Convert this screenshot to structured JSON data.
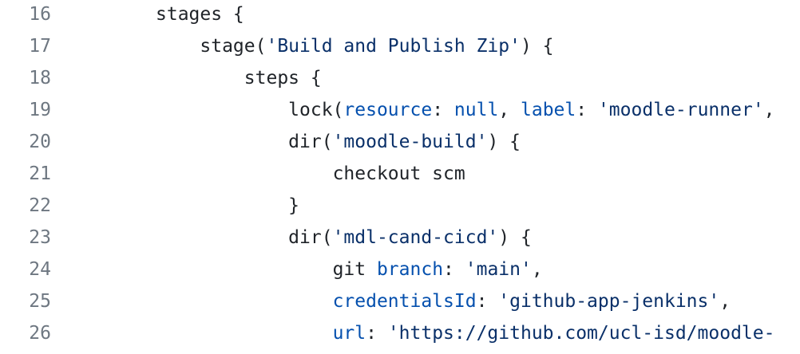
{
  "editor": {
    "lines": [
      {
        "number": "16",
        "indent": "",
        "tokens": [
          {
            "t": "stages {",
            "k": "plain"
          }
        ]
      },
      {
        "number": "17",
        "indent": "    ",
        "tokens": [
          {
            "t": "stage(",
            "k": "plain"
          },
          {
            "t": "'Build and Publish Zip'",
            "k": "string"
          },
          {
            "t": ") {",
            "k": "plain"
          }
        ]
      },
      {
        "number": "18",
        "indent": "        ",
        "tokens": [
          {
            "t": "steps {",
            "k": "plain"
          }
        ]
      },
      {
        "number": "19",
        "indent": "            ",
        "tokens": [
          {
            "t": "lock(",
            "k": "plain"
          },
          {
            "t": "resource",
            "k": "key"
          },
          {
            "t": ": ",
            "k": "plain"
          },
          {
            "t": "null",
            "k": "key"
          },
          {
            "t": ", ",
            "k": "plain"
          },
          {
            "t": "label",
            "k": "key"
          },
          {
            "t": ": ",
            "k": "plain"
          },
          {
            "t": "'moodle-runner'",
            "k": "string"
          },
          {
            "t": ",",
            "k": "plain"
          }
        ]
      },
      {
        "number": "20",
        "indent": "            ",
        "tokens": [
          {
            "t": "dir(",
            "k": "plain"
          },
          {
            "t": "'moodle-build'",
            "k": "string"
          },
          {
            "t": ") {",
            "k": "plain"
          }
        ]
      },
      {
        "number": "21",
        "indent": "                ",
        "tokens": [
          {
            "t": "checkout scm",
            "k": "plain"
          }
        ]
      },
      {
        "number": "22",
        "indent": "            ",
        "tokens": [
          {
            "t": "}",
            "k": "plain"
          }
        ]
      },
      {
        "number": "23",
        "indent": "            ",
        "tokens": [
          {
            "t": "dir(",
            "k": "plain"
          },
          {
            "t": "'mdl-cand-cicd'",
            "k": "string"
          },
          {
            "t": ") {",
            "k": "plain"
          }
        ]
      },
      {
        "number": "24",
        "indent": "                ",
        "tokens": [
          {
            "t": "git ",
            "k": "plain"
          },
          {
            "t": "branch",
            "k": "key"
          },
          {
            "t": ": ",
            "k": "plain"
          },
          {
            "t": "'main'",
            "k": "string"
          },
          {
            "t": ",",
            "k": "plain"
          }
        ]
      },
      {
        "number": "25",
        "indent": "                ",
        "tokens": [
          {
            "t": "credentialsId",
            "k": "key"
          },
          {
            "t": ": ",
            "k": "plain"
          },
          {
            "t": "'github-app-jenkins'",
            "k": "string"
          },
          {
            "t": ",",
            "k": "plain"
          }
        ]
      },
      {
        "number": "26",
        "indent": "                ",
        "tokens": [
          {
            "t": "url",
            "k": "key"
          },
          {
            "t": ": ",
            "k": "plain"
          },
          {
            "t": "'https://github.com/ucl-isd/moodle-",
            "k": "string"
          }
        ]
      }
    ]
  }
}
